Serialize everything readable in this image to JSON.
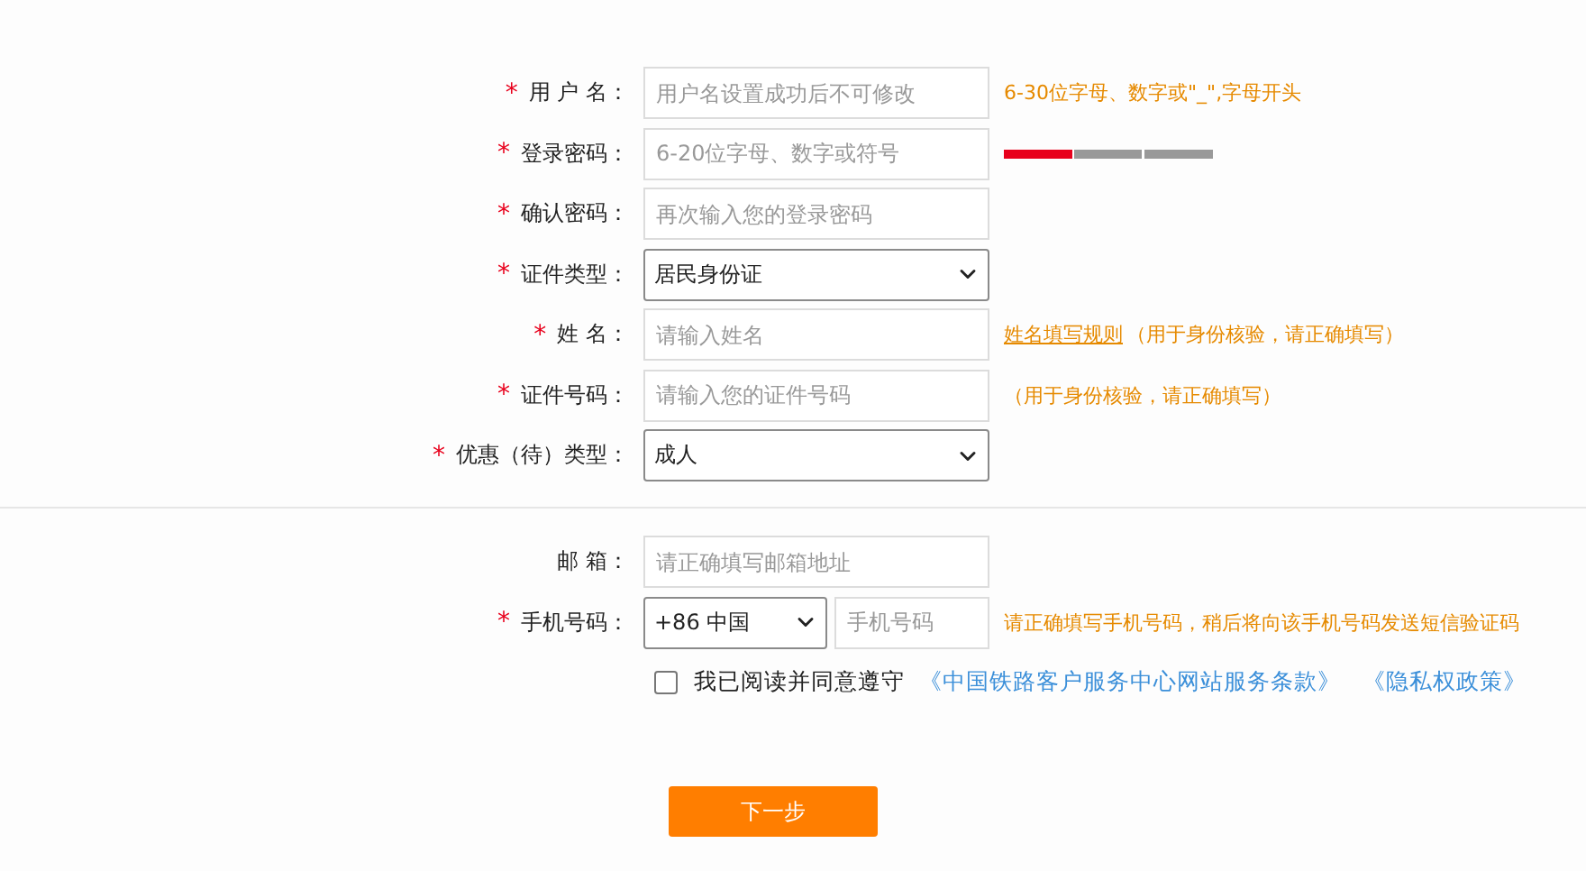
{
  "sections": [
    {
      "fields": [
        {
          "label": "用 户 名：",
          "mark": "*",
          "kind": "text",
          "placeholder": "用户名设置成功后不可修改",
          "hint": {
            "text": "6-30位字母、数字或\"_\",字母开头"
          }
        },
        {
          "label": "登录密码：",
          "mark": "*",
          "kind": "text",
          "placeholder": "6-20位字母、数字或符号",
          "strength": {
            "level": 0.33
          }
        },
        {
          "label": "确认密码：",
          "mark": "*",
          "kind": "text",
          "placeholder": "再次输入您的登录密码"
        },
        {
          "label": "证件类型：",
          "mark": "*",
          "kind": "select",
          "value": "居民身份证"
        },
        {
          "label": "姓 名：",
          "mark": "*",
          "kind": "text",
          "placeholder": "请输入姓名",
          "hint": {
            "link": "姓名填写规则",
            "text": "（用于身份核验，请正确填写）"
          }
        },
        {
          "label": "证件号码：",
          "mark": "*",
          "kind": "text",
          "placeholder": "请输入您的证件号码",
          "hint": {
            "text": "（用于身份核验，请正确填写）"
          }
        },
        {
          "label": "优惠（待）类型：",
          "mark": "*",
          "kind": "select",
          "value": "成人"
        }
      ]
    },
    {
      "fields": [
        {
          "label": "邮 箱：",
          "kind": "text",
          "placeholder": "请正确填写邮箱地址"
        },
        {
          "label": "手机号码：",
          "mark": "*",
          "kind": "phone",
          "country": "+86 中国",
          "placeholder": "手机号码",
          "hint": {
            "text": "请正确填写手机号码，稍后将向该手机号码发送短信验证码"
          }
        }
      ]
    }
  ],
  "agreement": {
    "checked": false,
    "text": "我已阅读并同意遵守",
    "links": [
      "《中国铁路客户服务中心网站服务条款》",
      "《隐私权政策》"
    ]
  },
  "next_button": "下一步"
}
